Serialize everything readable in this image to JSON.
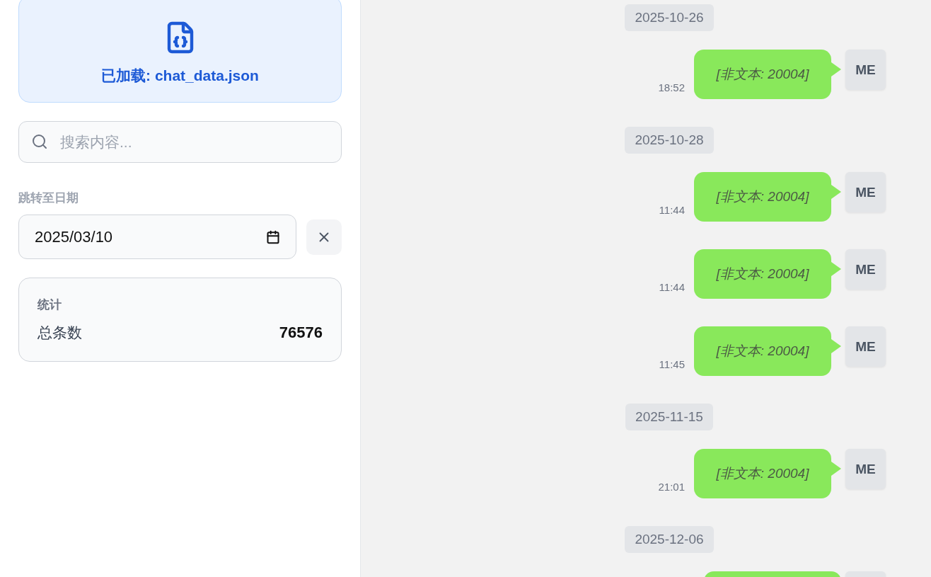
{
  "file_card": {
    "label": "已加载: chat_data.json"
  },
  "search": {
    "placeholder": "搜索内容..."
  },
  "date_jump": {
    "label": "跳转至日期",
    "value": "2025/03/10"
  },
  "stats": {
    "title": "统计",
    "rows": [
      {
        "label": "总条数",
        "value": "76576"
      }
    ]
  },
  "chat": [
    {
      "kind": "date",
      "text": "2025-10-26"
    },
    {
      "kind": "message",
      "time": "18:52",
      "text": "[非文本: 20004]",
      "avatar": "ME"
    },
    {
      "kind": "date",
      "text": "2025-10-28"
    },
    {
      "kind": "message",
      "time": "11:44",
      "text": "[非文本: 20004]",
      "avatar": "ME"
    },
    {
      "kind": "message",
      "time": "11:44",
      "text": "[非文本: 20004]",
      "avatar": "ME"
    },
    {
      "kind": "message",
      "time": "11:45",
      "text": "[非文本: 20004]",
      "avatar": "ME"
    },
    {
      "kind": "date",
      "text": "2025-11-15"
    },
    {
      "kind": "message",
      "time": "21:01",
      "text": "[非文本: 20004]",
      "avatar": "ME"
    },
    {
      "kind": "date",
      "text": "2025-12-06"
    },
    {
      "kind": "message"
    }
  ]
}
